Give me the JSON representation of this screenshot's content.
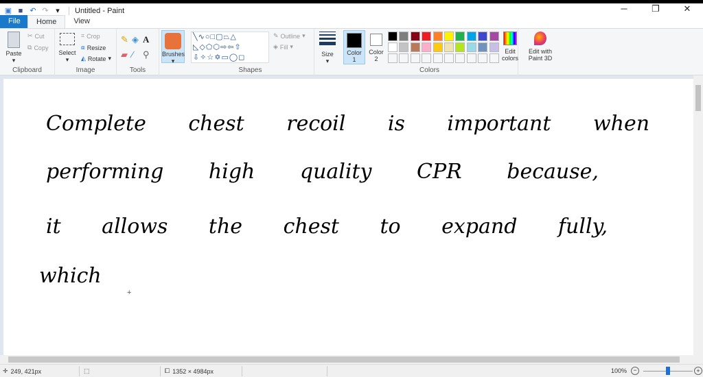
{
  "window": {
    "title": "Untitled - Paint"
  },
  "tabs": [
    "File",
    "Home",
    "View"
  ],
  "ribbon": {
    "clipboard": {
      "label": "Clipboard",
      "paste": "Paste",
      "cut": "Cut",
      "copy": "Copy"
    },
    "image": {
      "label": "Image",
      "select": "Select",
      "crop": "Crop",
      "resize": "Resize",
      "rotate": "Rotate"
    },
    "tools": {
      "label": "Tools"
    },
    "brushes": "Brushes",
    "shapes": {
      "label": "Shapes",
      "outline": "Outline",
      "fill": "Fill"
    },
    "size": "Size",
    "colors": {
      "label": "Colors",
      "color1": "Color",
      "color1_num": "1",
      "color2": "Color",
      "color2_num": "2",
      "edit_colors": "Edit colors",
      "palette": [
        "#000000",
        "#7f7f7f",
        "#880015",
        "#ed1c24",
        "#ff7f27",
        "#fff200",
        "#22b14c",
        "#00a2e8",
        "#3f48cc",
        "#a349a4",
        "#ffffff",
        "#c3c3c3",
        "#b97a57",
        "#ffaec9",
        "#ffc90e",
        "#efe4b0",
        "#b5e61d",
        "#99d9ea",
        "#7092be",
        "#c8bfe7"
      ]
    },
    "paint3d": "Edit with Paint 3D"
  },
  "canvas": {
    "lines": [
      "Complete chest recoil is important when",
      "performing high quality CPR because,",
      "it allows the chest to expand fully,",
      "which"
    ]
  },
  "status": {
    "cursor": "249, 421px",
    "canvas_size": "1352 × 4984px",
    "zoom": "100%",
    "zoom_level": 100
  }
}
